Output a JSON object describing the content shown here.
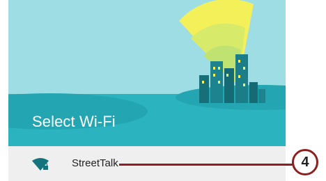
{
  "screen": {
    "title": "Select Wi-Fi"
  },
  "networks": [
    {
      "ssid": "StreetTalk",
      "secured": true,
      "icon": "wifi-lock-icon"
    }
  ],
  "callout": {
    "number": "4"
  },
  "colors": {
    "teal": "#2bb3bf",
    "sky": "#9edde4",
    "wifi_wave": "#f4f05a",
    "row_background": "#efefef",
    "callout": "#8d1f1f"
  }
}
